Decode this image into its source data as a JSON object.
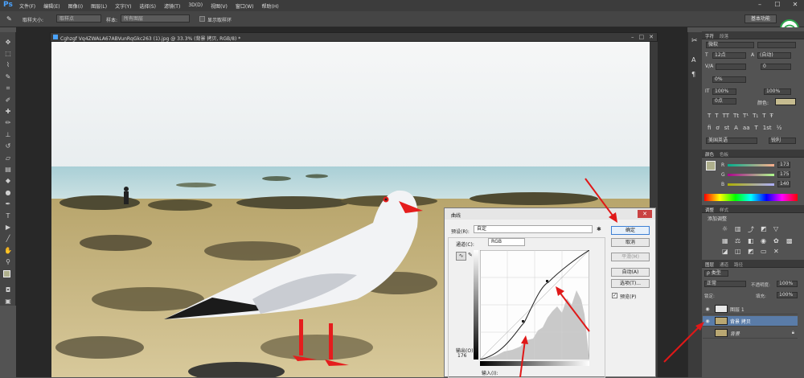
{
  "app": {
    "logo": "Ps"
  },
  "menu": [
    "文件(F)",
    "编辑(E)",
    "图像(I)",
    "图层(L)",
    "文字(Y)",
    "选择(S)",
    "滤镜(T)",
    "3D(D)",
    "视图(V)",
    "窗口(W)",
    "帮助(H)"
  ],
  "window_controls": [
    "–",
    "☐",
    "✕"
  ],
  "options_bar": {
    "sample_size_label": "取样大小:",
    "sample_size_value": "取样点",
    "sample_label": "样本:",
    "sample_value": "所有图层",
    "show_ring_label": "显示取样环",
    "workspace_label": "基本功能"
  },
  "document": {
    "title": "Cghzgf Vq4ZWALA67ABVunRqGkc263 (1).jpg @ 33.3% (背景 拷贝, RGB/8) *"
  },
  "panels": {
    "character_tabs": [
      "字符",
      "段落"
    ],
    "font_value": "微软",
    "size_value": "12点",
    "leading_value": "(自动)",
    "tracking_value": "0",
    "scale_value": "0%",
    "vscale_value": "100%",
    "hscale_value": "100%",
    "baseline_value": "0点",
    "color_label": "颜色:",
    "lang_value": "美国英语",
    "aa_value": "锐利",
    "color_tabs": [
      "颜色",
      "色板"
    ],
    "rgb_labels": [
      "R",
      "G",
      "B"
    ],
    "rgb_values": [
      "173",
      "175",
      "140"
    ],
    "adjust_tabs": [
      "调整",
      "样式"
    ],
    "adjust_add": "添加调整",
    "layers_tabs": [
      "图层",
      "通道",
      "路径"
    ],
    "layer_filter": "ρ 类型",
    "blend_mode": "正常",
    "opacity_label": "不透明度:",
    "opacity_value": "100%",
    "lock_label": "锁定:",
    "fill_label": "填充:",
    "fill_value": "100%",
    "layers": [
      {
        "name": "图层 1",
        "selected": false
      },
      {
        "name": "背景 拷贝",
        "selected": true
      },
      {
        "name": "背景",
        "selected": false
      }
    ]
  },
  "curves_dialog": {
    "title": "曲线",
    "preset_label": "预设(R):",
    "preset_value": "自定",
    "channel_label": "通道(C):",
    "channel_value": "RGB",
    "output_label": "输出(O):",
    "output_value": "176",
    "input_label": "输入(I):",
    "buttons": {
      "ok": "确定",
      "cancel": "取消",
      "smooth": "平滑(M)",
      "auto": "自动(A)",
      "options": "选项(T)..."
    },
    "preview_label": "预览(P)"
  },
  "colors": {
    "accent": "#4aa3ff",
    "arrow": "#e01818",
    "selected_layer": "#5a7ca8"
  }
}
